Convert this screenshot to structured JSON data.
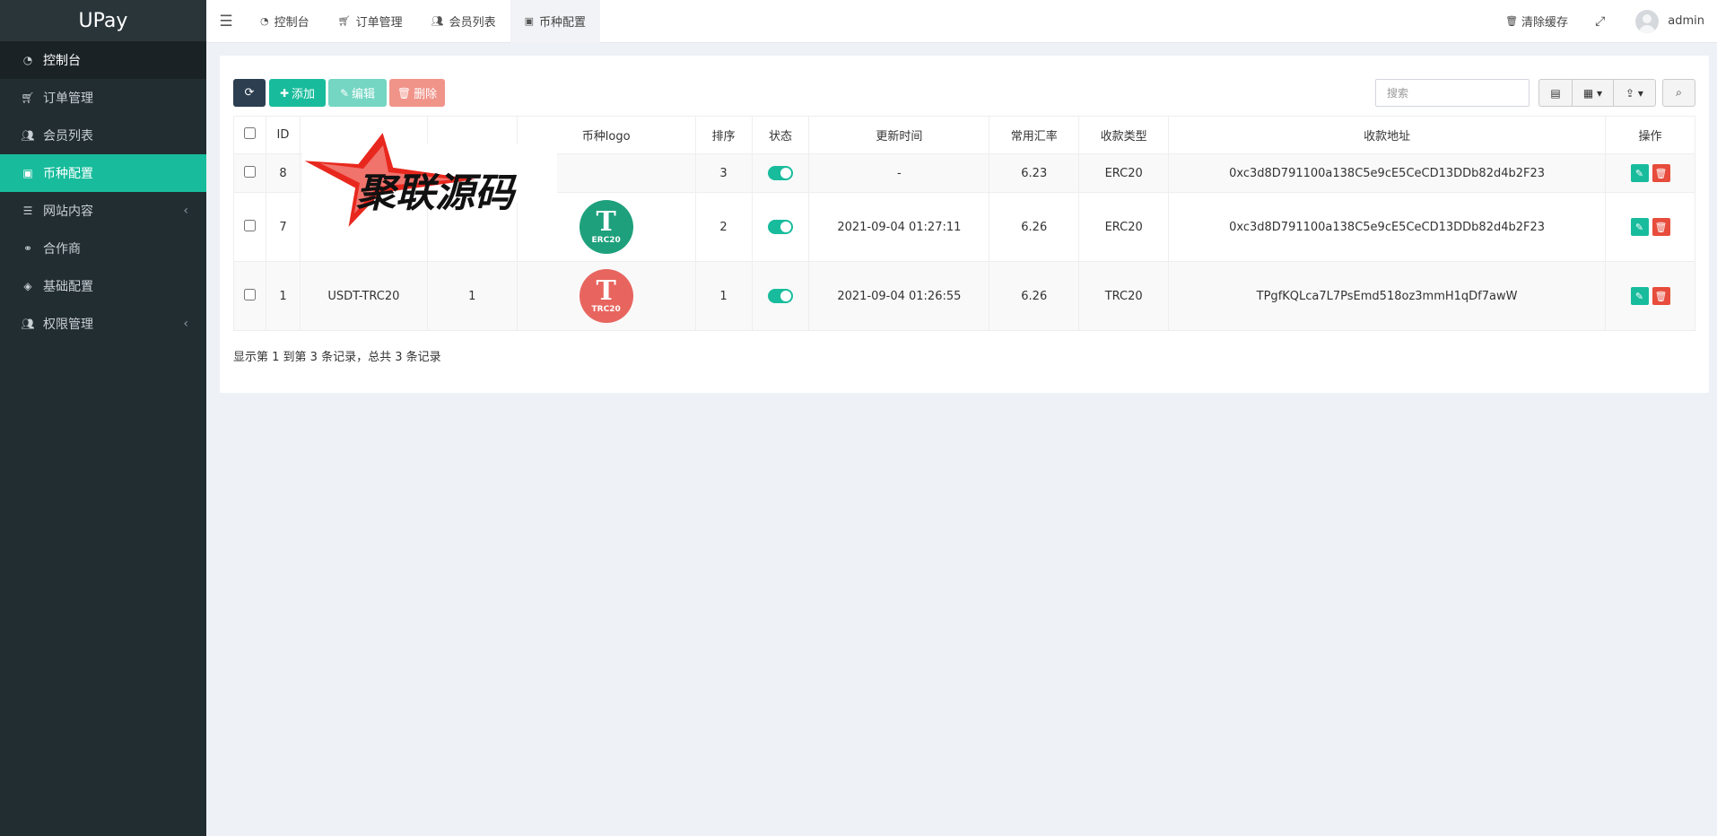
{
  "brand": "UPay",
  "sidebar": {
    "items": [
      {
        "label": "控制台",
        "icon": "dashboard-icon"
      },
      {
        "label": "订单管理",
        "icon": "cart-icon"
      },
      {
        "label": "会员列表",
        "icon": "users-icon"
      },
      {
        "label": "币种配置",
        "icon": "money-icon"
      },
      {
        "label": "网站内容",
        "icon": "list-icon"
      },
      {
        "label": "合作商",
        "icon": "handshake-icon"
      },
      {
        "label": "基础配置",
        "icon": "cube-icon"
      },
      {
        "label": "权限管理",
        "icon": "users-icon"
      }
    ]
  },
  "topbar": {
    "tabs": [
      {
        "label": "控制台",
        "icon": "dashboard-icon"
      },
      {
        "label": "订单管理",
        "icon": "cart-icon"
      },
      {
        "label": "会员列表",
        "icon": "users-icon"
      },
      {
        "label": "币种配置",
        "icon": "money-icon"
      }
    ],
    "clear_cache": "清除缓存",
    "username": "admin"
  },
  "toolbar": {
    "add": "添加",
    "edit": "编辑",
    "delete": "删除",
    "search_placeholder": "搜索"
  },
  "table": {
    "headers": [
      "ID",
      "",
      "",
      "币种logo",
      "排序",
      "状态",
      "更新时间",
      "常用汇率",
      "收款类型",
      "收款地址",
      "操作"
    ],
    "rows": [
      {
        "id": "8",
        "name": "",
        "col3": "",
        "logo": "",
        "sort": "3",
        "status": true,
        "updated": "-",
        "rate": "6.23",
        "type": "ERC20",
        "address": "0xc3d8D791100a138C5e9cE5CeCD13DDb82d4b2F23"
      },
      {
        "id": "7",
        "name": "",
        "col3": "",
        "logo": "ERC20",
        "sort": "2",
        "status": true,
        "updated": "2021-09-04 01:27:11",
        "rate": "6.26",
        "type": "ERC20",
        "address": "0xc3d8D791100a138C5e9cE5CeCD13DDb82d4b2F23"
      },
      {
        "id": "1",
        "name": "USDT-TRC20",
        "col3": "1",
        "logo": "TRC20",
        "sort": "1",
        "status": true,
        "updated": "2021-09-04 01:26:55",
        "rate": "6.26",
        "type": "TRC20",
        "address": "TPgfKQLca7L7PsEmd518oz3mmH1qDf7awW"
      }
    ]
  },
  "footer_info": "显示第 1 到第 3 条记录，总共 3 条记录",
  "watermark_text": "聚联源码",
  "colors": {
    "sidebar_bg": "#222d32",
    "accent": "#18bc9c",
    "danger": "#e74c3c",
    "dark_btn": "#2c3e50"
  }
}
